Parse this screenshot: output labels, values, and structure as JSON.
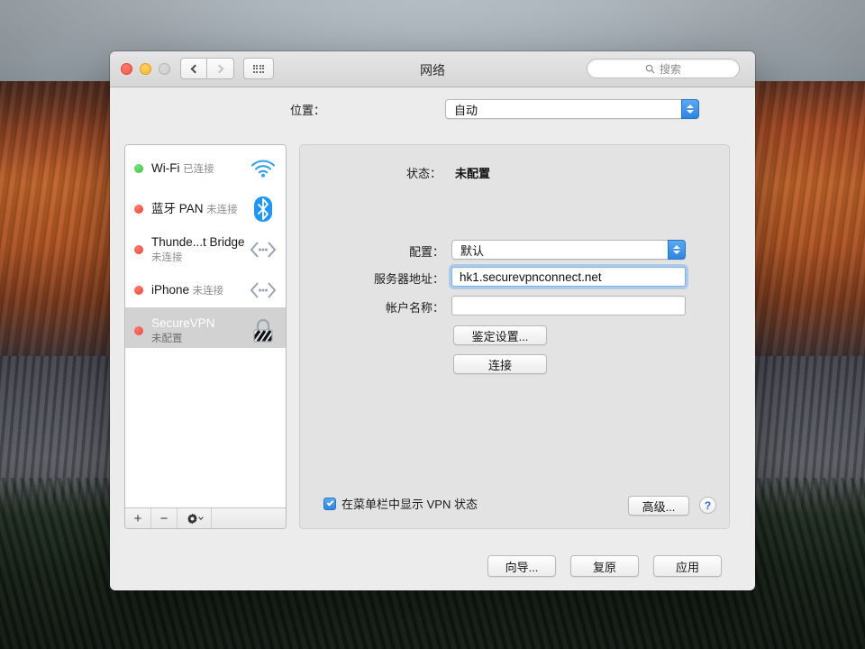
{
  "window": {
    "title": "网络",
    "traffic_lights": [
      "close",
      "minimize",
      "zoom"
    ],
    "nav": {
      "back": "back-icon",
      "forward": "forward-icon",
      "show_all": "grid-icon"
    },
    "search": {
      "placeholder": "搜索",
      "icon": "search-icon"
    }
  },
  "location": {
    "label": "位置：",
    "value": "自动"
  },
  "sidebar": {
    "services": [
      {
        "name": "Wi-Fi",
        "status": "已连接",
        "dot": "green",
        "icon": "wifi-icon",
        "selected": false
      },
      {
        "name": "蓝牙 PAN",
        "status": "未连接",
        "dot": "red",
        "icon": "bluetooth-icon",
        "selected": false
      },
      {
        "name": "Thunde...t Bridge",
        "status": "未连接",
        "dot": "red",
        "icon": "thunderbolt-bridge-icon",
        "selected": false
      },
      {
        "name": "iPhone",
        "status": "未连接",
        "dot": "red",
        "icon": "thunderbolt-bridge-icon",
        "selected": false
      },
      {
        "name": "SecureVPN",
        "status": "未配置",
        "dot": "red",
        "icon": "vpn-lock-icon",
        "selected": true
      }
    ],
    "footer": {
      "add": "+",
      "remove": "−",
      "actions_icon": "gear-icon"
    }
  },
  "panel": {
    "status_label": "状态：",
    "status_value": "未配置",
    "config_label": "配置：",
    "config_value": "默认",
    "server_label": "服务器地址：",
    "server_value": "hk1.securevpnconnect.net",
    "account_label": "帐户名称：",
    "account_value": "",
    "auth_button": "鉴定设置...",
    "connect_button": "连接",
    "show_vpn_status_label": "在菜单栏中显示 VPN 状态",
    "show_vpn_status_checked": true,
    "advanced_button": "高级...",
    "help_button": "?"
  },
  "footer": {
    "assistant_button": "向导...",
    "revert_button": "复原",
    "apply_button": "应用"
  },
  "colors": {
    "accent": "#2f86e0",
    "connected_dot": "#34c23a",
    "disconnected_dot": "#f04334",
    "selected_row": "#d2d2d2"
  }
}
